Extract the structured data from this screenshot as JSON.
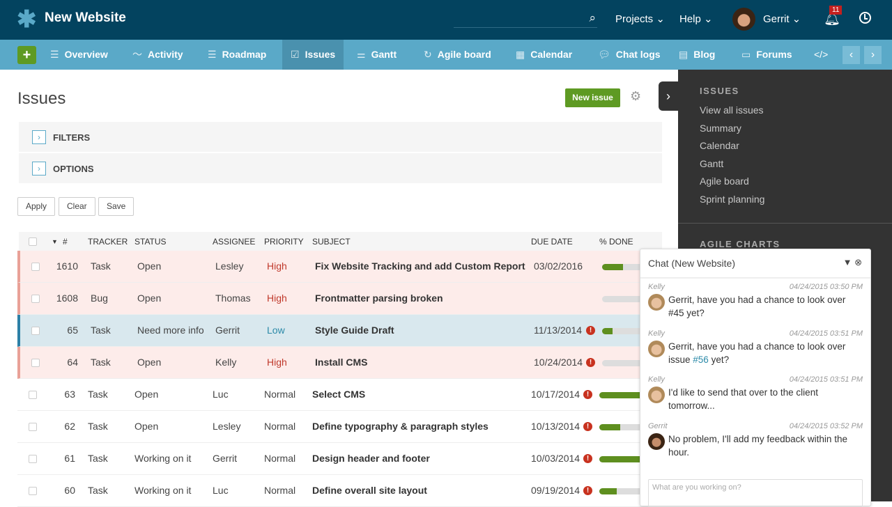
{
  "header": {
    "project_title": "New Website",
    "menus": [
      "Projects",
      "Help"
    ],
    "user": "Gerrit",
    "notifications": "11"
  },
  "nav": {
    "items": [
      {
        "label": "Overview",
        "icon": "list-icon"
      },
      {
        "label": "Activity",
        "icon": "pulse-icon"
      },
      {
        "label": "Roadmap",
        "icon": "roadmap-icon"
      },
      {
        "label": "Issues",
        "icon": "checkbox-icon",
        "active": true
      },
      {
        "label": "Gantt",
        "icon": "gantt-icon"
      },
      {
        "label": "Agile board",
        "icon": "agile-icon"
      },
      {
        "label": "Calendar",
        "icon": "calendar-icon"
      },
      {
        "label": "Chat logs",
        "icon": "chat-icon"
      },
      {
        "label": "Blog",
        "icon": "newspaper-icon"
      },
      {
        "label": "Forums",
        "icon": "forum-icon"
      }
    ]
  },
  "page": {
    "title": "Issues",
    "new_issue": "New issue",
    "filters": "FILTERS",
    "options": "OPTIONS",
    "apply": "Apply",
    "clear": "Clear",
    "save": "Save"
  },
  "table": {
    "columns": [
      "#",
      "TRACKER",
      "STATUS",
      "ASSIGNEE",
      "PRIORITY",
      "SUBJECT",
      "DUE DATE",
      "% DONE"
    ],
    "rows": [
      {
        "id": "1610",
        "tracker": "Task",
        "status": "Open",
        "assignee": "Lesley",
        "priority": "High",
        "subject": "Fix Website Tracking and add Custom Report",
        "due": "03/02/2016",
        "overdue": false,
        "done": 30,
        "highlight": "high"
      },
      {
        "id": "1608",
        "tracker": "Bug",
        "status": "Open",
        "assignee": "Thomas",
        "priority": "High",
        "subject": "Frontmatter parsing broken",
        "due": "",
        "overdue": false,
        "done": 0,
        "highlight": "high"
      },
      {
        "id": "65",
        "tracker": "Task",
        "status": "Need more info",
        "assignee": "Gerrit",
        "priority": "Low",
        "subject": "Style Guide Draft",
        "due": "11/13/2014",
        "overdue": true,
        "done": 15,
        "highlight": "selected"
      },
      {
        "id": "64",
        "tracker": "Task",
        "status": "Open",
        "assignee": "Kelly",
        "priority": "High",
        "subject": "Install CMS",
        "due": "10/24/2014",
        "overdue": true,
        "done": 0,
        "highlight": "high"
      },
      {
        "id": "63",
        "tracker": "Task",
        "status": "Open",
        "assignee": "Luc",
        "priority": "Normal",
        "subject": "Select CMS",
        "due": "10/17/2014",
        "overdue": true,
        "done": 70,
        "highlight": ""
      },
      {
        "id": "62",
        "tracker": "Task",
        "status": "Open",
        "assignee": "Lesley",
        "priority": "Normal",
        "subject": "Define typography & paragraph styles",
        "due": "10/13/2014",
        "overdue": true,
        "done": 30,
        "highlight": ""
      },
      {
        "id": "61",
        "tracker": "Task",
        "status": "Working on it",
        "assignee": "Gerrit",
        "priority": "Normal",
        "subject": "Design header and footer",
        "due": "10/03/2014",
        "overdue": true,
        "done": 70,
        "highlight": ""
      },
      {
        "id": "60",
        "tracker": "Task",
        "status": "Working on it",
        "assignee": "Luc",
        "priority": "Normal",
        "subject": "Define overall site layout",
        "due": "09/19/2014",
        "overdue": true,
        "done": 25,
        "highlight": ""
      }
    ]
  },
  "sidebar": {
    "issues_title": "ISSUES",
    "links": [
      "View all issues",
      "Summary",
      "Calendar",
      "Gantt",
      "Agile board",
      "Sprint planning"
    ],
    "charts_title": "AGILE CHARTS"
  },
  "chat": {
    "title": "Chat (New Website)",
    "placeholder": "What are you working on?",
    "messages": [
      {
        "author": "Kelly",
        "time": "04/24/2015 03:50 PM",
        "text": "Gerrit, have you had a chance to look over #45 yet?"
      },
      {
        "author": "Kelly",
        "time": "04/24/2015 03:51 PM",
        "text": "Gerrit, have you had a chance to look over issue ",
        "link": "#56",
        "after": " yet?"
      },
      {
        "author": "Kelly",
        "time": "04/24/2015 03:51 PM",
        "text": "I'd like to send that over to the client tomorrow..."
      },
      {
        "author": "Gerrit",
        "time": "04/24/2015 03:52 PM",
        "text": "No problem, I'll add my feedback within the hour."
      }
    ]
  },
  "colors": {
    "topbar": "#03435f",
    "nav": "#5aa9c8",
    "accent_green": "#5e9a23",
    "high": "#c0392b",
    "low": "#2b8aa8",
    "sidebar": "#333333"
  }
}
